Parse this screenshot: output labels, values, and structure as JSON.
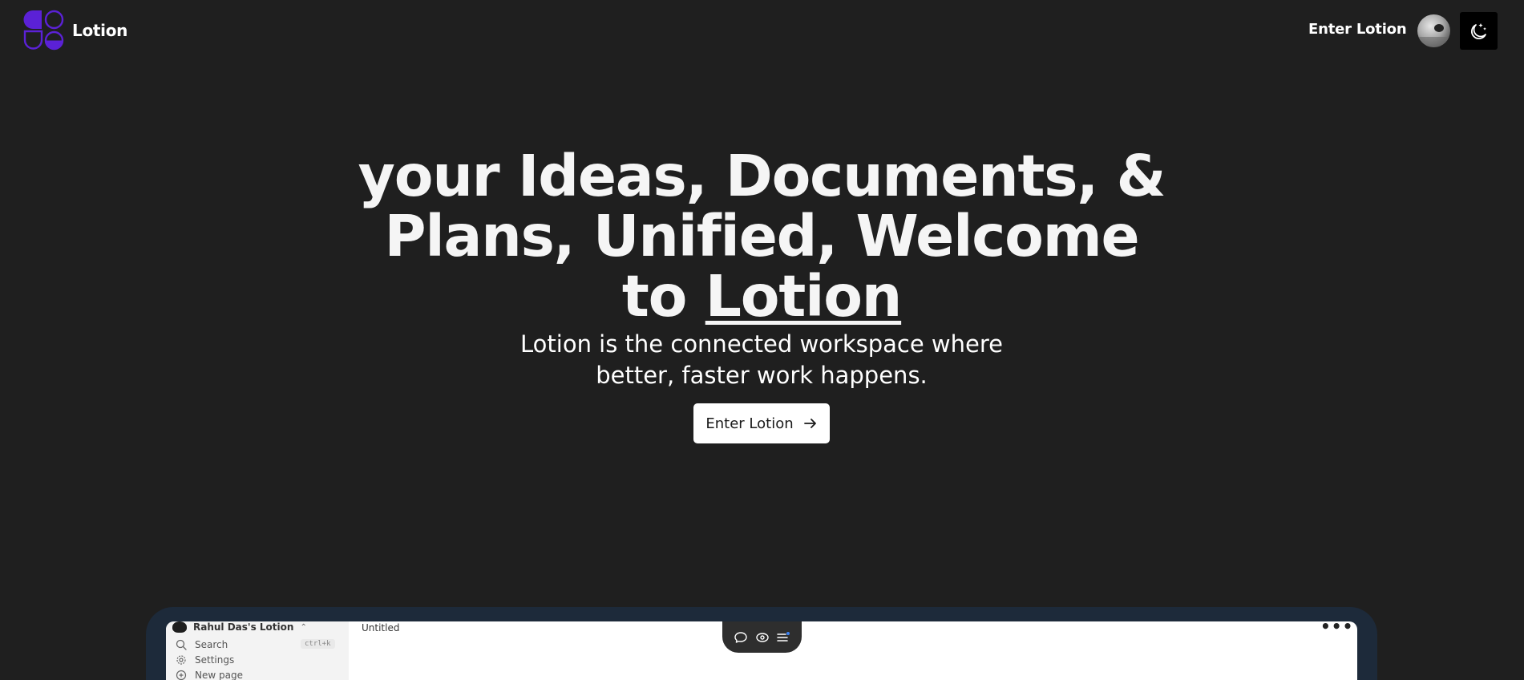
{
  "nav": {
    "brand_name": "Lotion",
    "enter_label": "Enter Lotion",
    "logo_color": "#5b21d6",
    "avatar_icon": "user-avatar-icon",
    "theme_icon": "moon-stars-icon"
  },
  "hero": {
    "title_prefix": "your Ideas, Documents, & Plans, Unified, Welcome to",
    "title_brand": "Lotion",
    "subtitle": "Lotion is the connected workspace where better, faster work happens.",
    "cta_label": "Enter Lotion",
    "cta_icon": "arrow-right-icon"
  },
  "preview": {
    "workspace_name": "Rahul Das's Lotion",
    "workspace_chevron": "⌃",
    "sidebar_items": [
      {
        "label": "Search",
        "icon": "search-icon",
        "shortcut": "ctrl+k"
      },
      {
        "label": "Settings",
        "icon": "settings-icon"
      },
      {
        "label": "New page",
        "icon": "plus-circle-icon"
      }
    ],
    "doc_title": "Untitled",
    "more_label": "•••",
    "toolbar_icons": [
      "comment-icon",
      "preview-icon",
      "menu-icon"
    ]
  },
  "colors": {
    "background": "#1f1f1f",
    "accent": "#5b21d6",
    "preview_frame": "#1d2a3a"
  }
}
